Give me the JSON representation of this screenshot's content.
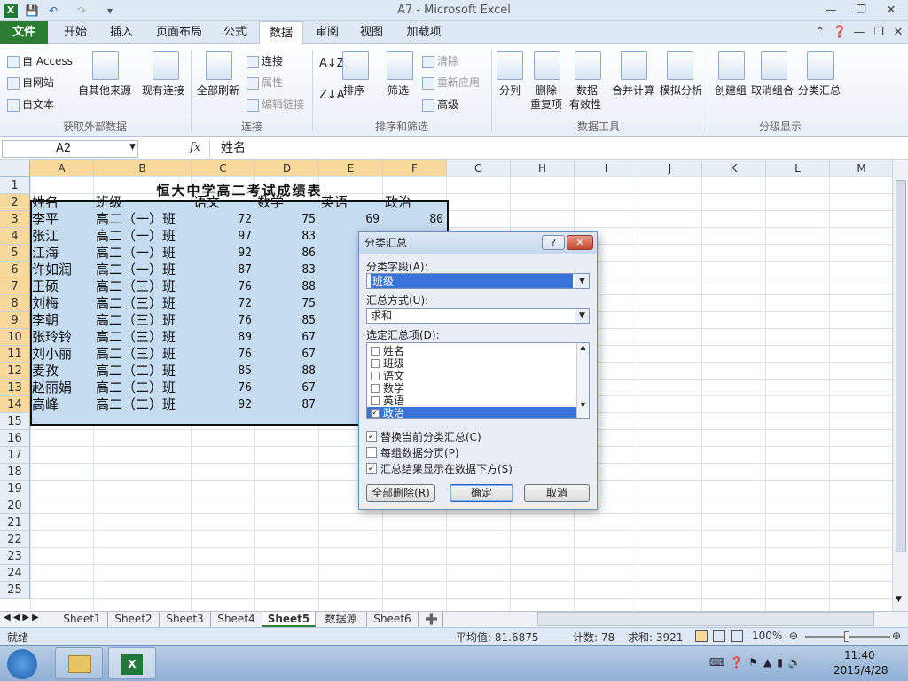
{
  "window": {
    "title": "A7 - Microsoft Excel"
  },
  "tabs": [
    "文件",
    "开始",
    "插入",
    "页面布局",
    "公式",
    "数据",
    "审阅",
    "视图",
    "加载项"
  ],
  "ribbon": {
    "get_external": {
      "access": "自 Access",
      "web": "自网站",
      "text": "自文本",
      "other": "自其他来源",
      "existing": "现有连接",
      "label": "获取外部数据"
    },
    "connections": {
      "refresh_all": "全部刷新",
      "connections": "连接",
      "properties": "属性",
      "edit_links": "编辑链接",
      "label": "连接"
    },
    "sort_filter": {
      "sort": "排序",
      "filter": "筛选",
      "clear": "清除",
      "reapply": "重新应用",
      "advanced": "高级",
      "label": "排序和筛选"
    },
    "data_tools": {
      "text_to_columns": "分列",
      "remove_dup_1": "删除",
      "remove_dup_2": "重复项",
      "validation_1": "数据",
      "validation_2": "有效性",
      "consolidate": "合并计算",
      "whatif": "模拟分析",
      "label": "数据工具"
    },
    "outline": {
      "group": "创建组",
      "ungroup": "取消组合",
      "subtotal": "分类汇总",
      "label": "分级显示"
    }
  },
  "formula_bar": {
    "name_box": "A2",
    "fx": "fx",
    "value": "姓名"
  },
  "grid": {
    "columns": [
      "A",
      "B",
      "C",
      "D",
      "E",
      "F",
      "G",
      "H",
      "I",
      "J",
      "K",
      "L",
      "M"
    ],
    "rows": [
      "1",
      "2",
      "3",
      "4",
      "5",
      "6",
      "7",
      "8",
      "9",
      "10",
      "11",
      "12",
      "13",
      "14",
      "15",
      "16",
      "17",
      "18",
      "19",
      "20",
      "21",
      "22",
      "23",
      "24",
      "25"
    ],
    "sheet_title": "恒大中学高二考试成绩表",
    "headers": [
      "姓名",
      "班级",
      "语文",
      "数学",
      "英语",
      "政治"
    ],
    "records": [
      {
        "name": "李平",
        "class": "高二（一）班",
        "chinese": "72",
        "math": "75",
        "english": "69",
        "politics": "80"
      },
      {
        "name": "张江",
        "class": "高二（一）班",
        "chinese": "97",
        "math": "83"
      },
      {
        "name": "江海",
        "class": "高二（一）班",
        "chinese": "92",
        "math": "86"
      },
      {
        "name": "许如润",
        "class": "高二（一）班",
        "chinese": "87",
        "math": "83"
      },
      {
        "name": "王硕",
        "class": "高二（三）班",
        "chinese": "76",
        "math": "88"
      },
      {
        "name": "刘梅",
        "class": "高二（三）班",
        "chinese": "72",
        "math": "75"
      },
      {
        "name": "李朝",
        "class": "高二（三）班",
        "chinese": "76",
        "math": "85"
      },
      {
        "name": "张玲铃",
        "class": "高二（三）班",
        "chinese": "89",
        "math": "67"
      },
      {
        "name": "刘小丽",
        "class": "高二（三）班",
        "chinese": "76",
        "math": "67"
      },
      {
        "name": "麦孜",
        "class": "高二（二）班",
        "chinese": "85",
        "math": "88"
      },
      {
        "name": "赵丽娟",
        "class": "高二（二）班",
        "chinese": "76",
        "math": "67"
      },
      {
        "name": "高峰",
        "class": "高二（二）班",
        "chinese": "92",
        "math": "87"
      }
    ]
  },
  "sheets": [
    "Sheet1",
    "Sheet2",
    "Sheet3",
    "Sheet4",
    "Sheet5",
    "数据源",
    "Sheet6"
  ],
  "active_sheet": "Sheet5",
  "status": {
    "mode": "就绪",
    "average": "平均值: 81.6875",
    "count": "计数: 78",
    "sum": "求和: 3921",
    "zoom": "100%"
  },
  "taskbar": {
    "time": "11:40",
    "date": "2015/4/28"
  },
  "dialog": {
    "title": "分类汇总",
    "help": "?",
    "close": "✕",
    "group_by_label": "分类字段(A):",
    "group_by_value": "班级",
    "function_label": "汇总方式(U):",
    "function_value": "求和",
    "add_to_label": "选定汇总项(D):",
    "fields": [
      {
        "label": "姓名",
        "checked": false
      },
      {
        "label": "班级",
        "checked": false
      },
      {
        "label": "语文",
        "checked": false
      },
      {
        "label": "数学",
        "checked": false
      },
      {
        "label": "英语",
        "checked": false
      },
      {
        "label": "政治",
        "checked": true
      }
    ],
    "replace_current": "替换当前分类汇总(C)",
    "page_break": "每组数据分页(P)",
    "summary_below": "汇总结果显示在数据下方(S)",
    "remove_all": "全部删除(R)",
    "ok": "确定",
    "cancel": "取消"
  },
  "colors": {
    "selection": "#c5dcf1",
    "header_selected": "#f9d99b",
    "file_tab": "#2a7d32",
    "list_highlight": "#3874d9"
  }
}
